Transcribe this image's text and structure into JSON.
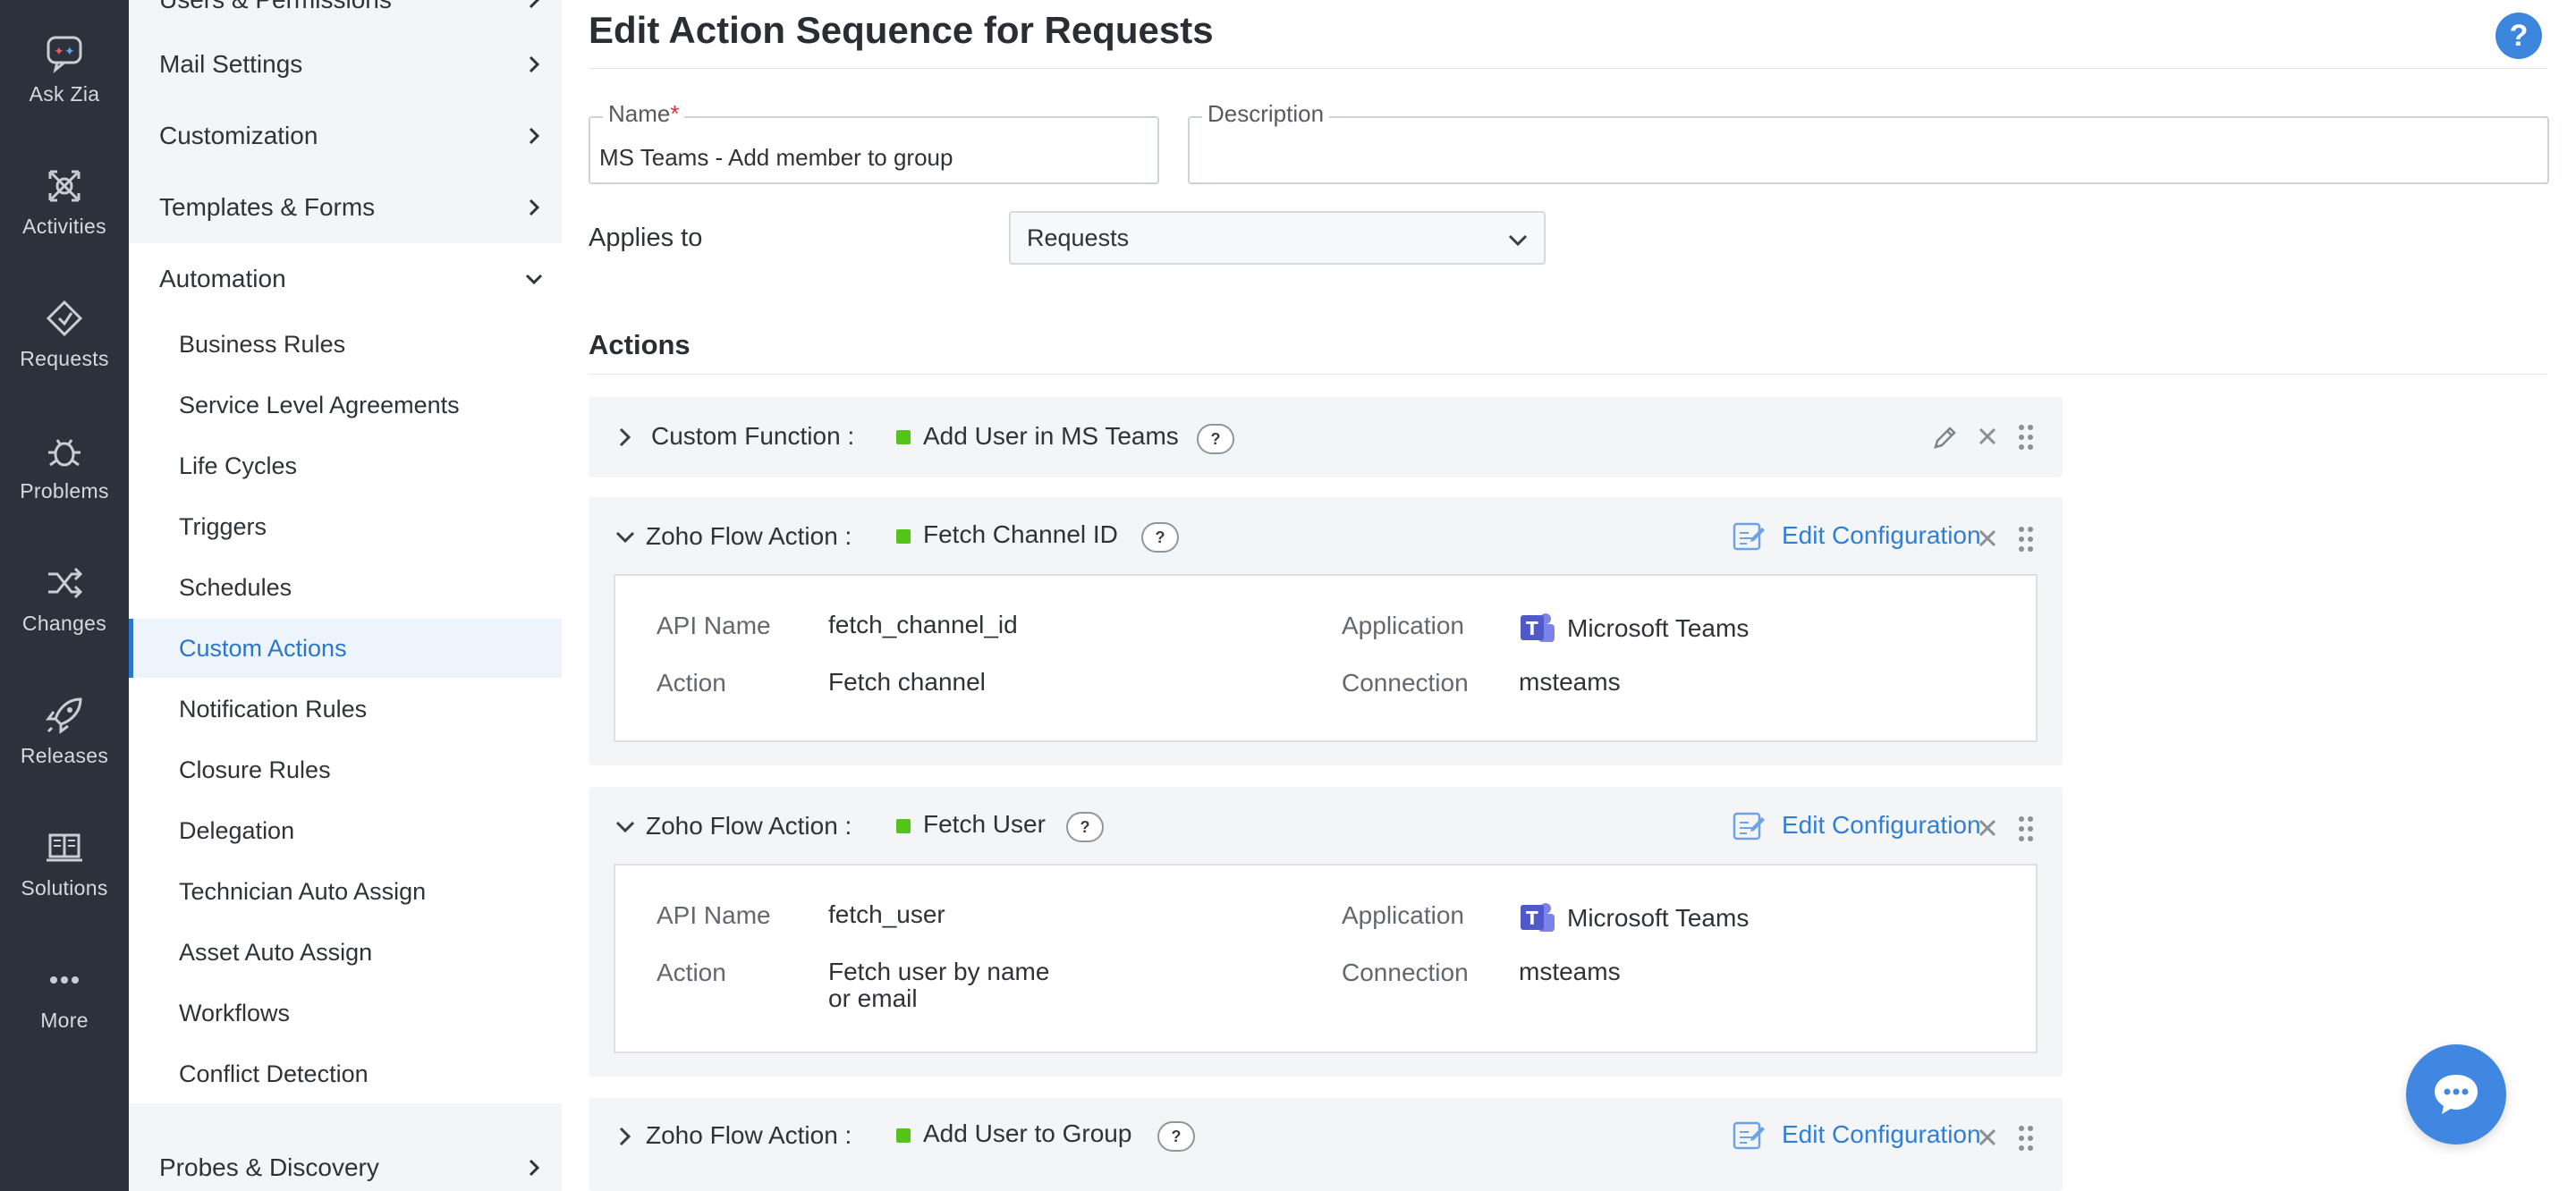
{
  "rail": {
    "items": [
      {
        "label": "Ask Zia",
        "icon": "ask-zia-icon"
      },
      {
        "label": "Activities",
        "icon": "activities-icon"
      },
      {
        "label": "Requests",
        "icon": "requests-icon"
      },
      {
        "label": "Problems",
        "icon": "problems-icon"
      },
      {
        "label": "Changes",
        "icon": "changes-icon"
      },
      {
        "label": "Releases",
        "icon": "releases-icon"
      },
      {
        "label": "Solutions",
        "icon": "solutions-icon"
      },
      {
        "label": "More",
        "icon": "more-icon"
      }
    ]
  },
  "sidebar": {
    "sections": [
      {
        "label": "Users & Permissions"
      },
      {
        "label": "Mail Settings"
      },
      {
        "label": "Customization"
      },
      {
        "label": "Templates & Forms"
      },
      {
        "label": "Automation"
      },
      {
        "label": "Probes & Discovery"
      }
    ],
    "automation_items": [
      {
        "label": "Business Rules"
      },
      {
        "label": "Service Level Agreements"
      },
      {
        "label": "Life Cycles"
      },
      {
        "label": "Triggers"
      },
      {
        "label": "Schedules"
      },
      {
        "label": "Custom Actions"
      },
      {
        "label": "Notification Rules"
      },
      {
        "label": "Closure Rules"
      },
      {
        "label": "Delegation"
      },
      {
        "label": "Technician Auto Assign"
      },
      {
        "label": "Asset Auto Assign"
      },
      {
        "label": "Workflows"
      },
      {
        "label": "Conflict Detection"
      }
    ]
  },
  "main": {
    "title": "Edit Action Sequence for Requests",
    "help_label": "?",
    "name_label": "Name",
    "required_mark": "*",
    "name_value": "MS Teams - Add member to group",
    "description_label": "Description",
    "description_value": "",
    "applies_to_label": "Applies to",
    "applies_to_value": "Requests",
    "actions_title": "Actions"
  },
  "actions": [
    {
      "type": "Custom Function :",
      "name": "Add User in MS Teams",
      "expanded": false
    },
    {
      "type": "Zoho Flow Action :",
      "name": "Fetch Channel ID",
      "edit_label": "Edit Configuration",
      "expanded": true,
      "api_name_label": "API Name",
      "api_name": "fetch_channel_id",
      "action_label": "Action",
      "action": "Fetch channel",
      "application_label": "Application",
      "application": "Microsoft Teams",
      "connection_label": "Connection",
      "connection": "msteams"
    },
    {
      "type": "Zoho Flow Action :",
      "name": "Fetch User",
      "edit_label": "Edit Configuration",
      "expanded": true,
      "api_name_label": "API Name",
      "api_name": "fetch_user",
      "action_label": "Action",
      "action_line1": "Fetch user by name",
      "action_line2": "or email",
      "application_label": "Application",
      "application": "Microsoft Teams",
      "connection_label": "Connection",
      "connection": "msteams"
    },
    {
      "type": "Zoho Flow Action :",
      "name": "Add User to Group",
      "edit_label": "Edit Configuration",
      "expanded": false
    }
  ],
  "colors": {
    "rail_bg": "#2b323b",
    "sidebar_bg": "#f4f5f7",
    "accent": "#2a77c9",
    "status_green": "#54c41a",
    "chat_button": "#3f87e0"
  }
}
